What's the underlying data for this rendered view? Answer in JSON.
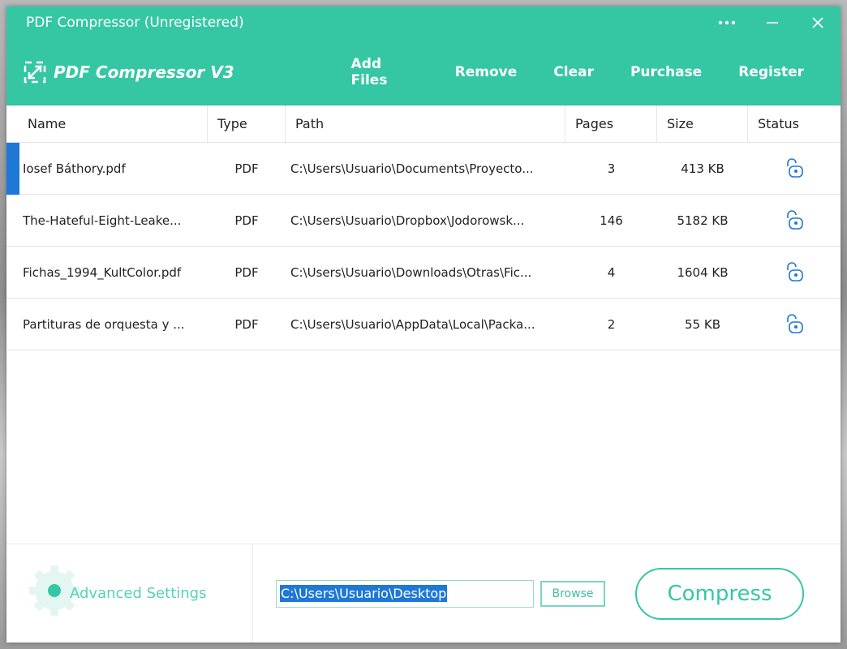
{
  "window": {
    "title": "PDF Compressor (Unregistered)",
    "brand": "PDF Compressor V3",
    "accent_color": "#35c7a3",
    "selection_color": "#1e78d6"
  },
  "toolbar": {
    "add_files": "Add Files",
    "remove": "Remove",
    "clear": "Clear",
    "purchase": "Purchase",
    "register": "Register"
  },
  "table": {
    "headers": [
      "Name",
      "Type",
      "Path",
      "Pages",
      "Size",
      "Status"
    ],
    "rows": [
      {
        "name": "Iosef Báthory.pdf",
        "type": "PDF",
        "path": "C:\\Users\\Usuario\\Documents\\Proyecto...",
        "pages": "3",
        "size": "413 KB",
        "status_icon": "unlock-icon"
      },
      {
        "name": "The-Hateful-Eight-Leake...",
        "type": "PDF",
        "path": "C:\\Users\\Usuario\\Dropbox\\Jodorowsk...",
        "pages": "146",
        "size": "5182 KB",
        "status_icon": "unlock-icon"
      },
      {
        "name": "Fichas_1994_KultColor.pdf",
        "type": "PDF",
        "path": "C:\\Users\\Usuario\\Downloads\\Otras\\Fic...",
        "pages": "4",
        "size": "1604 KB",
        "status_icon": "unlock-icon"
      },
      {
        "name": "Partituras de orquesta y ...",
        "type": "PDF",
        "path": "C:\\Users\\Usuario\\AppData\\Local\\Packa...",
        "pages": "2",
        "size": "55 KB",
        "status_icon": "unlock-icon"
      }
    ]
  },
  "bottom": {
    "advanced_settings": "Advanced Settings",
    "output_path": "C:\\Users\\Usuario\\Desktop",
    "browse": "Browse",
    "compress": "Compress"
  }
}
